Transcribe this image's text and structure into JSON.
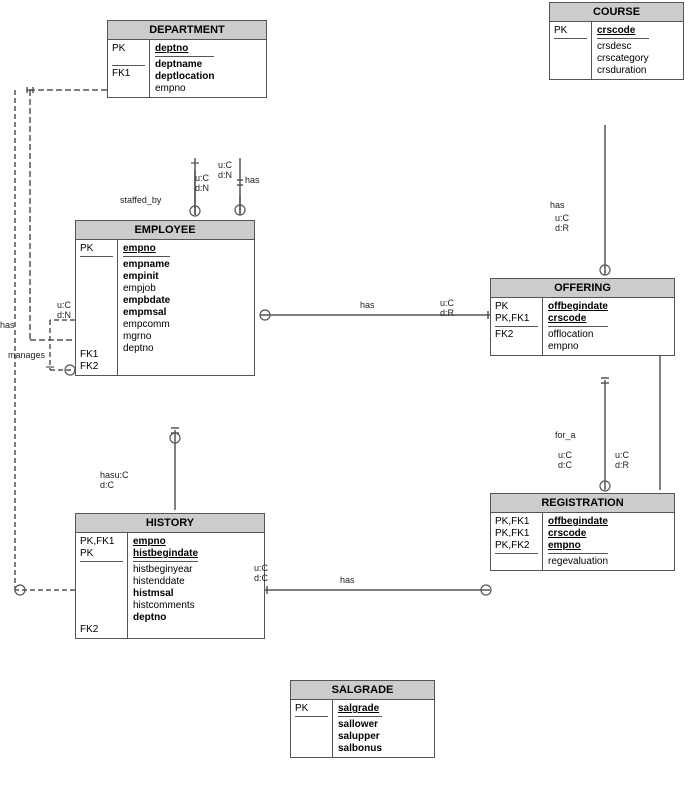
{
  "entities": {
    "department": {
      "title": "DEPARTMENT",
      "pk_labels": [
        "PK",
        "",
        "FK1"
      ],
      "pk_fields": [
        "deptno",
        "",
        "empno"
      ],
      "pk_underlines": [
        true,
        false,
        false
      ],
      "attrs_section1": [
        "deptname",
        "deptlocation"
      ],
      "attrs_section2": []
    },
    "employee": {
      "title": "EMPLOYEE",
      "pk_labels": [
        "PK"
      ],
      "pk_fields": [
        "empno"
      ],
      "pk_underlines": [
        true
      ],
      "attrs_bold": [
        "empname",
        "empinit",
        "empbdate",
        "empmsal"
      ],
      "attrs_normal": [
        "empjob",
        "empcomm",
        "mgrno",
        "deptno"
      ],
      "fk_labels": [
        "FK1",
        "FK2"
      ],
      "fk_fields": [
        "mgrno",
        "deptno"
      ]
    },
    "course": {
      "title": "COURSE",
      "pk_labels": [
        "PK"
      ],
      "pk_fields": [
        "crscode"
      ],
      "pk_underlines": [
        true
      ],
      "attrs": [
        "crsdesc",
        "crscategory",
        "crsduration"
      ]
    },
    "offering": {
      "title": "OFFERING",
      "pk_labels": [
        "PK",
        "PK,FK1",
        "FK2"
      ],
      "pk_fields": [
        "offbegindate",
        "crscode",
        "",
        "offlocation",
        "empno"
      ],
      "pk_underlines": [
        true,
        true,
        false,
        false,
        false
      ]
    },
    "history": {
      "title": "HISTORY",
      "pk_labels": [
        "PK,FK1",
        "PK",
        "FK2"
      ],
      "pk_fields": [
        "empno",
        "histbegindate",
        "",
        "deptno"
      ],
      "pk_underlines": [
        true,
        true
      ]
    },
    "registration": {
      "title": "REGISTRATION",
      "pk_labels": [
        "PK,FK1",
        "PK,FK1",
        "PK,FK2"
      ],
      "pk_fields": [
        "offbegindate",
        "crscode",
        "empno"
      ],
      "pk_underlines": [
        true,
        true,
        true
      ],
      "attrs": [
        "regevaluation"
      ]
    },
    "salgrade": {
      "title": "SALGRADE",
      "pk_labels": [
        "PK"
      ],
      "pk_fields": [
        "salgrade"
      ],
      "pk_underlines": [
        true
      ],
      "attrs": [
        "sallower",
        "salupper",
        "salbonus"
      ]
    }
  },
  "labels": {
    "has_top": "has",
    "staffed_by": "staffed_by",
    "has_right_dept": "has",
    "manages": "manages",
    "has_left": "has",
    "has_mid": "has",
    "has_bottom": "has",
    "for_a": "for_a"
  }
}
